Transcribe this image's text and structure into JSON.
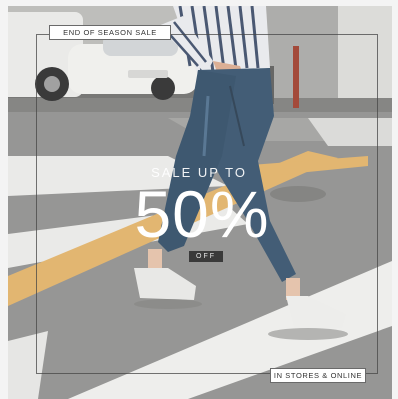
{
  "ad": {
    "top_tag": "END OF SEASON SALE",
    "headline": "SALE UP TO",
    "discount": "50%",
    "off_label": "OFF",
    "bottom_tag": "IN STORES & ONLINE"
  },
  "colors": {
    "road": "#8f8f8d",
    "crosswalk": "#eeeeee",
    "yellow_line": "#e2b266",
    "jeans": "#33506b",
    "shirt_stripe": "#3b4a66"
  }
}
